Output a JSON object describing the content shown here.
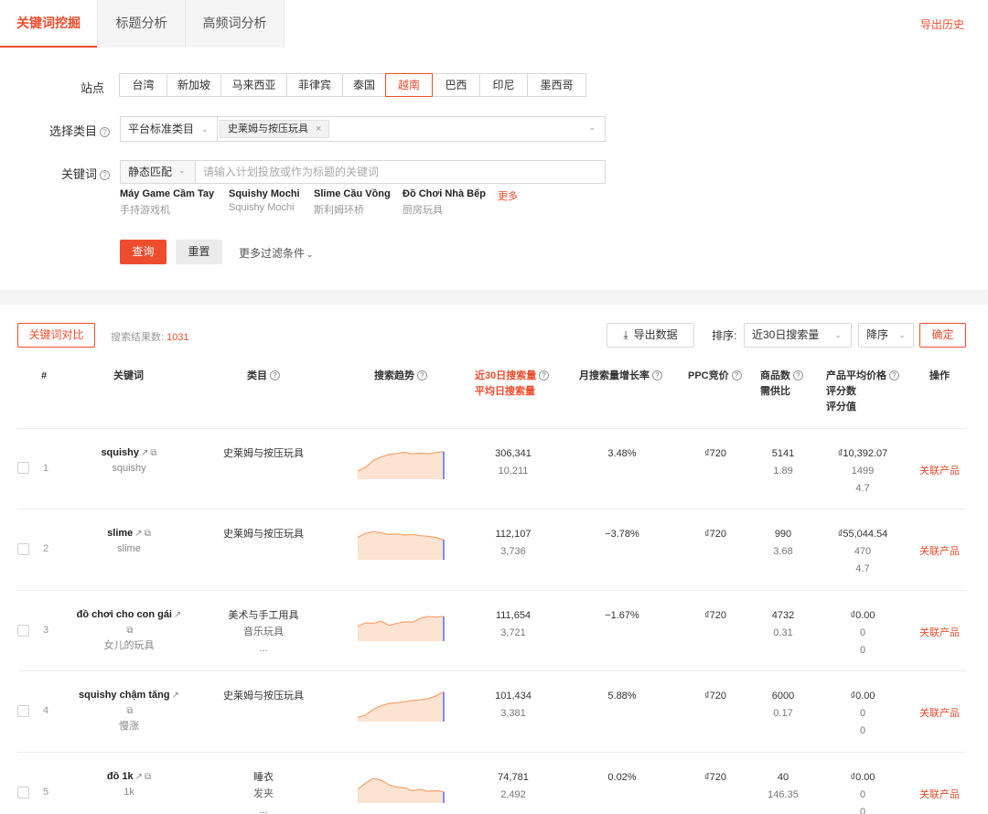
{
  "tabs": [
    "关键词挖掘",
    "标题分析",
    "高频词分析"
  ],
  "export_history": "导出历史",
  "filters": {
    "station_label": "站点",
    "stations": [
      "台湾",
      "新加坡",
      "马来西亚",
      "菲律宾",
      "泰国",
      "越南",
      "巴西",
      "印尼",
      "墨西哥"
    ],
    "active_station": "越南",
    "category_label": "选择类目",
    "category_select": "平台标准类目",
    "category_tag": "史莱姆与按压玩具",
    "keyword_label": "关键词",
    "match_select": "静态匹配",
    "keyword_placeholder": "请输入计划投放或作为标题的关键词",
    "suggestions": [
      {
        "term": "Máy Game Cầm Tay",
        "translation": "手持游戏机"
      },
      {
        "term": "Squishy Mochi",
        "translation": "Squishy Mochi"
      },
      {
        "term": "Slime Cầu Vồng",
        "translation": "斯利姆环桥"
      },
      {
        "term": "Đồ Chơi Nhà Bếp",
        "translation": "厨房玩具"
      }
    ],
    "more": "更多",
    "query_button": "查询",
    "reset_button": "重置",
    "more_filters": "更多过滤条件"
  },
  "toolbar": {
    "compare_button": "关键词对比",
    "result_count_label": "搜索结果数:",
    "result_count": "1031",
    "export_button": "导出数据",
    "sort_label": "排序:",
    "sort_value": "近30日搜索量",
    "order_value": "降序",
    "confirm_button": "确定"
  },
  "table": {
    "headers": {
      "index": "#",
      "keyword": "关键词",
      "category": "类目",
      "trend": "搜索趋势",
      "search_volume": "近30日搜索量",
      "daily_volume": "平均日搜索量",
      "growth": "月搜索量增长率",
      "ppc": "PPC竞价",
      "products": "商品数",
      "supply_ratio": "需供比",
      "avg_price": "产品平均价格",
      "rating_count": "评分数",
      "rating_value": "评分值",
      "action": "操作"
    },
    "rows": [
      {
        "index": "1",
        "keyword": "squishy",
        "translation": "squishy",
        "categories": [
          "史莱姆与按压玩具"
        ],
        "volume": "306,341",
        "daily": "10,211",
        "growth": "3.48%",
        "ppc": "₫720",
        "products": "5141",
        "ratio": "1.89",
        "price": "₫10,392.07",
        "rating_count": "1499",
        "rating": "4.7",
        "action": "关联产品",
        "trend": [
          22,
          34,
          58,
          70,
          78,
          82,
          86,
          80,
          83,
          81,
          85,
          88
        ]
      },
      {
        "index": "2",
        "keyword": "slime",
        "translation": "slime",
        "categories": [
          "史莱姆与按压玩具"
        ],
        "volume": "112,107",
        "daily": "3,736",
        "growth": "−3.78%",
        "ppc": "₫720",
        "products": "990",
        "ratio": "3.68",
        "price": "₫55,044.54",
        "rating_count": "470",
        "rating": "4.7",
        "action": "关联产品",
        "trend": [
          70,
          84,
          90,
          86,
          80,
          82,
          78,
          80,
          76,
          74,
          70,
          62
        ]
      },
      {
        "index": "3",
        "keyword": "đồ chơi cho con gái",
        "translation": "女儿的玩具",
        "categories": [
          "美术与手工用具",
          "音乐玩具",
          "..."
        ],
        "volume": "111,654",
        "daily": "3,721",
        "growth": "−1.67%",
        "ppc": "₫720",
        "products": "4732",
        "ratio": "0.31",
        "price": "₫0.00",
        "rating_count": "0",
        "rating": "0",
        "action": "关联产品",
        "trend": [
          45,
          56,
          55,
          62,
          48,
          54,
          60,
          58,
          72,
          78,
          76,
          78
        ]
      },
      {
        "index": "4",
        "keyword": "squishy chậm tăng",
        "translation": "慢涨",
        "categories": [
          "史莱姆与按压玩具"
        ],
        "volume": "101,434",
        "daily": "3,381",
        "growth": "5.88%",
        "ppc": "₫720",
        "products": "6000",
        "ratio": "0.17",
        "price": "₫0.00",
        "rating_count": "0",
        "rating": "0",
        "action": "关联产品",
        "trend": [
          8,
          16,
          36,
          48,
          56,
          58,
          62,
          66,
          68,
          72,
          82,
          95
        ]
      },
      {
        "index": "5",
        "keyword": "đồ 1k",
        "translation": "1k",
        "categories": [
          "睡衣",
          "发夹",
          "..."
        ],
        "volume": "74,781",
        "daily": "2,492",
        "growth": "0.02%",
        "ppc": "₫720",
        "products": "40",
        "ratio": "146.35",
        "price": "₫0.00",
        "rating_count": "0",
        "rating": "0",
        "action": "关联产品",
        "trend": [
          40,
          62,
          78,
          72,
          56,
          48,
          46,
          36,
          40,
          34,
          36,
          32
        ]
      }
    ]
  },
  "colors": {
    "accent": "#ee4d2d",
    "trend_fill": "#fde3d1",
    "trend_line": "#f5a36c",
    "trend_edge": "#7b8ff0"
  }
}
